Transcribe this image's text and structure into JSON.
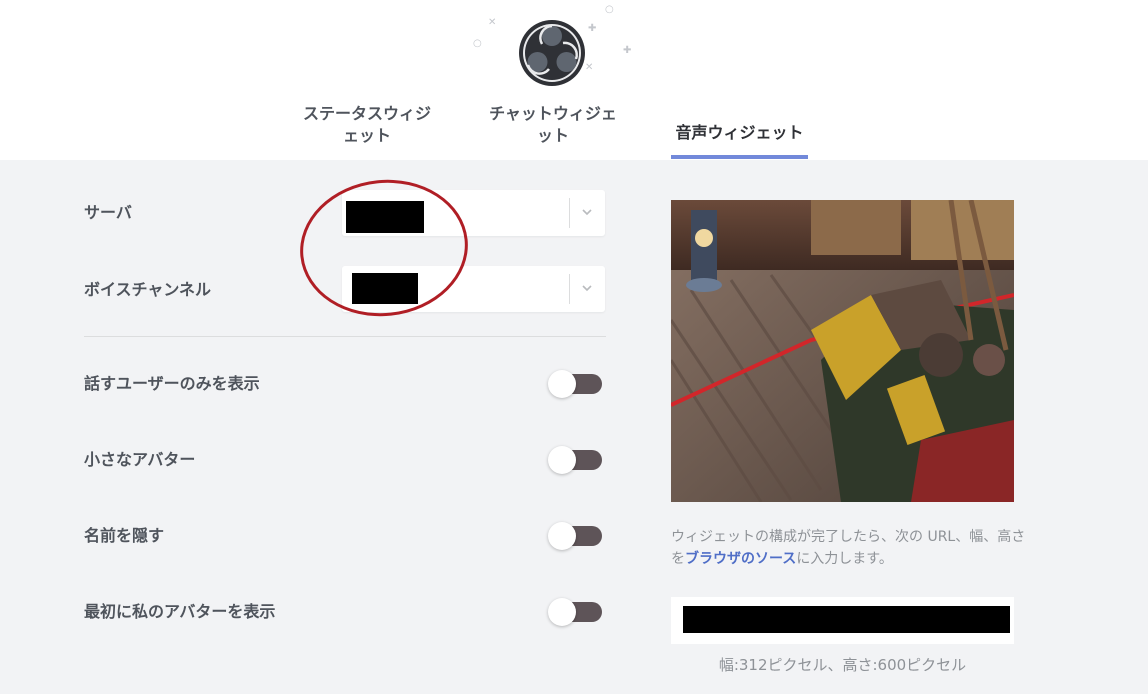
{
  "tabs": [
    {
      "label_line1": "ステータスウィジ",
      "label_line2": "ェット"
    },
    {
      "label_line1": "チャットウィジェ",
      "label_line2": "ット"
    },
    {
      "label_line1": "音声ウィジェット",
      "label_line2": ""
    }
  ],
  "active_tab": 2,
  "form": {
    "server_label": "サーバ",
    "voice_channel_label": "ボイスチャンネル"
  },
  "toggles": [
    {
      "label": "話すユーザーのみを表示",
      "on": false
    },
    {
      "label": "小さなアバター",
      "on": false
    },
    {
      "label": "名前を隠す",
      "on": false
    },
    {
      "label": "最初に私のアバターを表示",
      "on": false
    }
  ],
  "info": {
    "part1": "ウィジェットの構成が完了したら、次の URL、幅、高さを",
    "emphasis": "ブラウザのソース",
    "part2": "に入力します。"
  },
  "dimensions": "幅:312ピクセル、高さ:600ピクセル",
  "colors": {
    "accent": "#7289da",
    "toggle_off": "#5e5458",
    "annotation": "#b01e25",
    "background": "#f2f3f5"
  }
}
